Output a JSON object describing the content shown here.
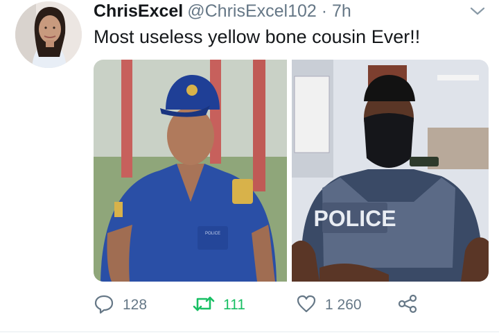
{
  "tweet": {
    "display_name": "ChrisExcel",
    "handle": "@ChrisExcel102",
    "separator": " · ",
    "time": "7h",
    "text": "Most useless yellow bone cousin Ever!!",
    "media": {
      "right_vest_text": "POLICE",
      "left_pocket_text": "POLICE"
    },
    "actions": {
      "reply_count": "128",
      "retweet_count": "111",
      "like_count": "1 260"
    }
  },
  "colors": {
    "text_primary": "#14171a",
    "text_secondary": "#657786",
    "retweet_green": "#17bf63",
    "icon_gray": "#657786",
    "divider": "#e6ecf0"
  },
  "icons": [
    "chevron-down-icon",
    "reply-icon",
    "retweet-icon",
    "like-icon",
    "share-icon"
  ]
}
